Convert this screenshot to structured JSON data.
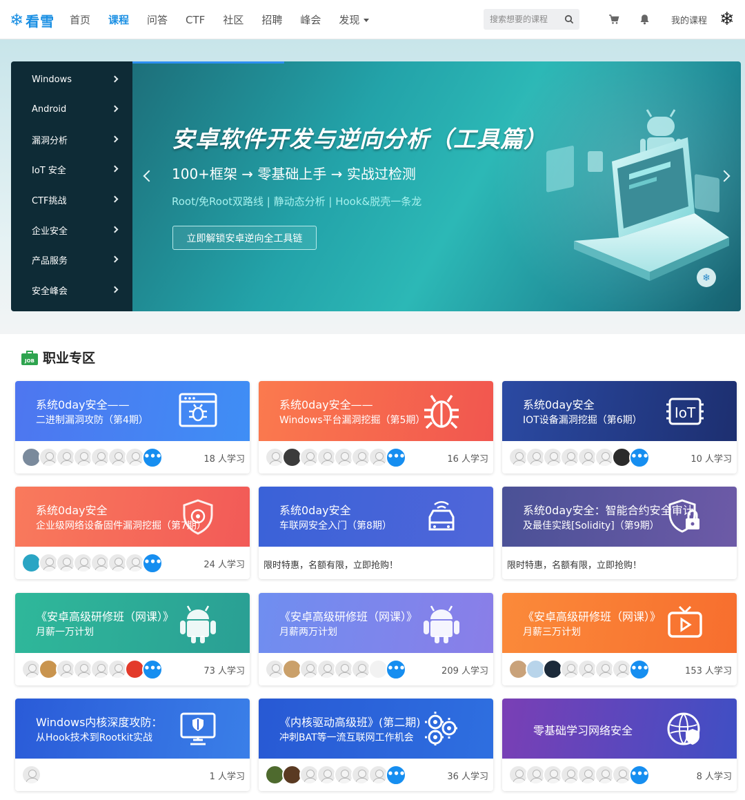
{
  "header": {
    "logo_text": "看雪",
    "nav": [
      "首页",
      "课程",
      "问答",
      "CTF",
      "社区",
      "招聘",
      "峰会",
      "发现"
    ],
    "active_index": 1,
    "search_placeholder": "搜索想要的课程",
    "my_course": "我的课程"
  },
  "sidebar": {
    "items": [
      "Windows",
      "Android",
      "漏洞分析",
      "IoT 安全",
      "CTF挑战",
      "企业安全",
      "产品服务",
      "安全峰会"
    ]
  },
  "banner": {
    "title": "安卓软件开发与逆向分析（工具篇）",
    "subtitle": "100+框架 → 零基础上手 → 实战过检测",
    "tags": "Root/免Root双路线 | 静动态分析 | Hook&脱壳一条龙",
    "button": "立即解锁安卓逆向全工具链"
  },
  "section": {
    "title": "职业专区",
    "badge": "JOB"
  },
  "cards": [
    {
      "t1": "系统0day安全——",
      "t2": "二进制漏洞攻防（第4期）",
      "icon": "bug-window-icon",
      "learners": "18 人学习",
      "grad": [
        "#4e76f0",
        "#3f8ef5"
      ]
    },
    {
      "t1": "系统0day安全——",
      "t2": "Windows平台漏洞挖掘（第5期）",
      "icon": "bug-icon",
      "learners": "16 人学习",
      "grad": [
        "#fb7a4e",
        "#f1564f"
      ]
    },
    {
      "t1": "系统0day安全",
      "t2": "IOT设备漏洞挖掘（第6期）",
      "icon": "iot-chip-icon",
      "learners": "10 人学习",
      "grad": [
        "#2b4aa3",
        "#1d2f70"
      ]
    },
    {
      "t1": "系统0day安全",
      "t2": "企业级网络设备固件漏洞挖掘（第7期）",
      "icon": "shield-icon",
      "learners": "24 人学习",
      "grad": [
        "#f97a5c",
        "#f25a57"
      ]
    },
    {
      "t1": "系统0day安全",
      "t2": "车联网安全入门（第8期）",
      "icon": "car-icon",
      "promo": "限时特惠，名额有限，立即抢购！",
      "grad": [
        "#3a62d8",
        "#5066d9"
      ]
    },
    {
      "t1": "系统0day安全：智能合约安全审计",
      "t2": "及最佳实践[Solidity]（第9期）",
      "icon": "lock-shield-icon",
      "promo": "限时特惠，名额有限，立即抢购！",
      "grad": [
        "#4a5196",
        "#6d5aa7"
      ]
    },
    {
      "t1": "《安卓高级研修班（网课）》",
      "t2": "月薪一万计划",
      "icon": "android-icon",
      "learners": "73 人学习",
      "grad": [
        "#2fb89a",
        "#2a9f94"
      ]
    },
    {
      "t1": "《安卓高级研修班（网课）》",
      "t2": "月薪两万计划",
      "icon": "android-icon",
      "learners": "209 人学习",
      "grad": [
        "#6f8ef0",
        "#8a7ee8"
      ]
    },
    {
      "t1": "《安卓高级研修班（网课）》",
      "t2": "月薪三万计划",
      "icon": "tv-play-icon",
      "learners": "153 人学习",
      "grad": [
        "#fb8a3a",
        "#f76e2e"
      ]
    },
    {
      "t1": "Windows内核深度攻防：",
      "t2": "从Hook技术到Rootkit实战",
      "icon": "monitor-shield-icon",
      "learners": "1 人学习",
      "grad": [
        "#2a5bd8",
        "#3a7fe8"
      ]
    },
    {
      "t1": "《内核驱动高级班》(第二期)",
      "t2": "冲刺BAT等一流互联网工作机会",
      "icon": "gears-icon",
      "learners": "36 人学习",
      "grad": [
        "#2859d4",
        "#2e6fe0"
      ]
    },
    {
      "t1": "零基础学习网络安全",
      "t2": "",
      "icon": "globe-shield-icon",
      "learners": "8 人学习",
      "grad": [
        "#7a3fb5",
        "#3f4fc4"
      ]
    }
  ]
}
